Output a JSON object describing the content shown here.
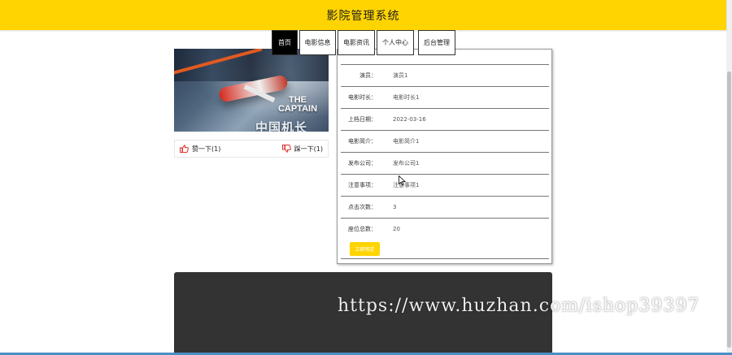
{
  "header": {
    "title": "影院管理系统"
  },
  "nav": {
    "items": [
      {
        "label": "首页",
        "active": true
      },
      {
        "label": "电影信息"
      },
      {
        "label": "电影资讯"
      },
      {
        "label": "个人中心"
      },
      {
        "label": "后台管理"
      }
    ]
  },
  "poster": {
    "title_en_line1": "THE",
    "title_en_line2": "CAPTAIN",
    "title_cn": "中国机长"
  },
  "votes": {
    "up_label": "赞一下(1)",
    "down_label": "踩一下(1)"
  },
  "details": [
    {
      "label": "演员：",
      "value": "演员1"
    },
    {
      "label": "电影时长：",
      "value": "电影时长1"
    },
    {
      "label": "上档日期：",
      "value": "2022-03-16"
    },
    {
      "label": "电影简介：",
      "value": "电影简介1"
    },
    {
      "label": "发布公司：",
      "value": "发布公司1"
    },
    {
      "label": "注意事项：",
      "value": "注意事项1"
    },
    {
      "label": "点击次数：",
      "value": "3"
    },
    {
      "label": "座位总数：",
      "value": "20"
    }
  ],
  "actions": {
    "book_label": "立即预定"
  },
  "watermark": "https://www.huzhan.com/ishop39397",
  "colors": {
    "accent": "#ffd400",
    "dark_block": "#333333",
    "vote_icon": "#d9322b"
  }
}
